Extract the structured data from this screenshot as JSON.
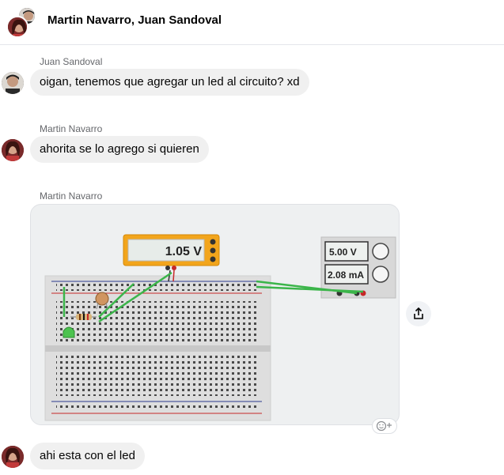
{
  "header": {
    "title": "Martin Navarro, Juan Sandoval"
  },
  "messages": [
    {
      "sender": "Juan Sandoval",
      "text": "oigan, tenemos que agregar un led al circuito? xd"
    },
    {
      "sender": "Martin Navarro",
      "text": "ahorita se lo agrego si quieren"
    },
    {
      "sender": "Martin Navarro",
      "type": "image"
    },
    {
      "text": "ahi esta con el led"
    }
  ],
  "circuit": {
    "multimeter_reading": "1.05 V",
    "supply_voltage": "5.00 V",
    "supply_current": "2.08 mA"
  },
  "icons": {
    "share": "share-icon",
    "react": "add-reaction-icon"
  }
}
